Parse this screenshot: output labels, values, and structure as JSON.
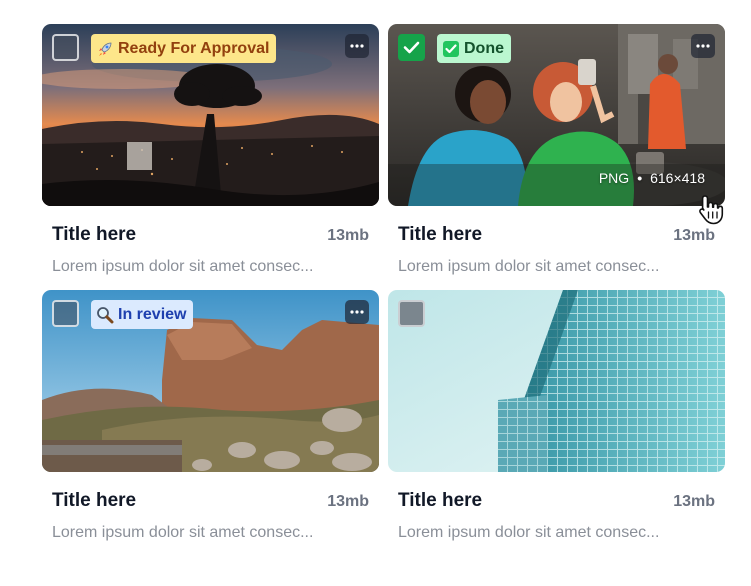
{
  "cards": [
    {
      "title": "Title here",
      "size": "13mb",
      "description": "Lorem ipsum dolor sit amet consec...",
      "badge": {
        "label": "Ready For Approval",
        "icon": "rocket-emoji",
        "color": "#fde68a"
      },
      "checked": false
    },
    {
      "title": "Title here",
      "size": "13mb",
      "description": "Lorem ipsum dolor sit amet consec...",
      "badge": {
        "label": "Done",
        "icon": "check-box-emoji",
        "color": "#bbf7d0"
      },
      "checked": true,
      "file_meta": {
        "format": "PNG",
        "separator": "•",
        "dimensions": "616×418"
      }
    },
    {
      "title": "Title here",
      "size": "13mb",
      "description": "Lorem ipsum dolor sit amet consec...",
      "badge": {
        "label": "In review",
        "icon": "magnifier-emoji",
        "color": "#dbeafe"
      },
      "checked": false
    },
    {
      "title": "Title here",
      "size": "13mb",
      "description": "Lorem ipsum dolor sit amet consec...",
      "checked": false
    }
  ],
  "colors": {
    "checked": "#16a34a",
    "title": "#111827",
    "muted": "#8a8f98"
  },
  "icons": {
    "more": "ellipsis-icon",
    "cursor": "hand-pointer-icon"
  }
}
